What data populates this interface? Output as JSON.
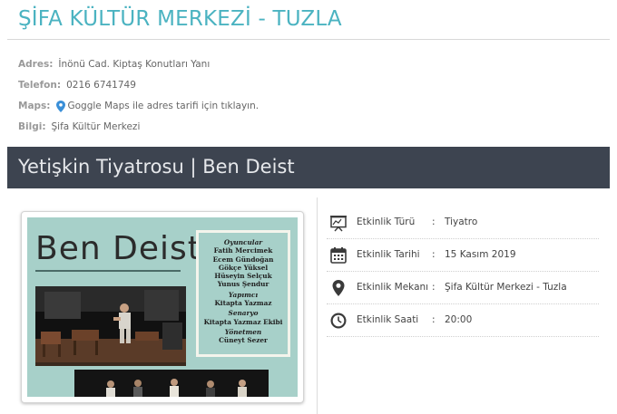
{
  "venue": {
    "title": "ŞİFA KÜLTÜR MERKEZİ - TUZLA",
    "info": [
      {
        "label": "Adres:",
        "value": "İnönü Cad. Kiptaş Konutları Yanı"
      },
      {
        "label": "Telefon:",
        "value": "0216 6741749"
      },
      {
        "label": "Maps:",
        "value": "Goggle Maps ile adres tarifi için tıklayın."
      },
      {
        "label": "Bilgi:",
        "value": "Şifa Kültür Merkezi"
      }
    ]
  },
  "event": {
    "title": "Yetişkin Tiyatrosu | Ben Deist"
  },
  "poster": {
    "title": "Ben Deist",
    "credits": {
      "cast_role": "Oyuncular",
      "cast": [
        "Fatih Mercimek",
        "Ecem Gündoğan",
        "Gökçe Yüksel",
        "Hüseyin Selçuk",
        "Yunus Şendur"
      ],
      "producer_role": "Yapımcı",
      "producer": "Kitapta Yazmaz",
      "writer_role": "Senaryo",
      "writer": "Kitapta Yazmaz Ekibi",
      "director_role": "Yönetmen",
      "director": "Cüneyt Sezer"
    }
  },
  "details": [
    {
      "icon": "presentation-icon",
      "label": "Etkinlik Türü",
      "colon": ":",
      "value": "Tiyatro"
    },
    {
      "icon": "calendar-icon",
      "label": "Etkinlik Tarihi",
      "colon": ":",
      "value": "15 Kasım 2019"
    },
    {
      "icon": "location-pin-icon",
      "label": "Etkinlik Mekanı",
      "colon": ":",
      "value": "Şifa Kültür Merkezi - Tuzla"
    },
    {
      "icon": "clock-icon",
      "label": "Etkinlik Saati",
      "colon": ":",
      "value": "20:00"
    }
  ],
  "colors": {
    "title_accent": "#4bb3c1",
    "event_bar": "#3d4450",
    "poster_bg": "#a7d0c9",
    "pin": "#3a8fd8"
  }
}
